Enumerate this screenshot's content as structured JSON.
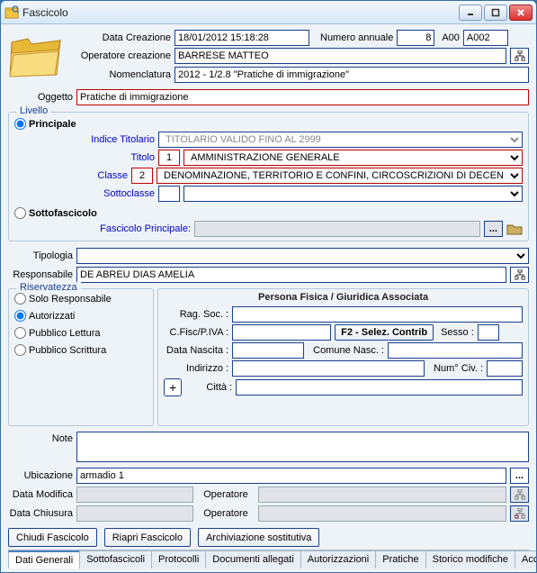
{
  "window": {
    "title": "Fascicolo"
  },
  "header": {
    "data_creazione_label": "Data Creazione",
    "data_creazione": "18/01/2012 15:18:28",
    "numero_annuale_label": "Numero annuale",
    "numero_annuale": "8",
    "aoo_label": "A00",
    "aoo_value": "A002",
    "operatore_creazione_label": "Operatore creazione",
    "operatore_creazione": "BARRESE MATTEO",
    "nomenclatura_label": "Nomenclatura",
    "nomenclatura": "2012 - 1/2.8 \"Pratiche di immigrazione\""
  },
  "oggetto": {
    "label": "Oggetto",
    "value": "Pratiche di immigrazione"
  },
  "livello": {
    "legend": "Livello",
    "principale": "Principale",
    "indice_titolario_label": "Indice Titolario",
    "indice_titolario": "TITOLARIO VALIDO FINO AL 2999",
    "titolo_label": "Titolo",
    "titolo_num": "1",
    "titolo_val": "AMMINISTRAZIONE GENERALE",
    "classe_label": "Classe",
    "classe_num": "2",
    "classe_val": "DENOMINAZIONE, TERRITORIO E CONFINI, CIRCOSCRIZIONI DI DECEN",
    "sottoclasse_label": "Sottoclasse",
    "sottoclasse_num": "",
    "sottoclasse_val": "",
    "sottofascicolo": "Sottofascicolo",
    "fascicolo_principale_label": "Fascicolo Principale:",
    "fascicolo_principale": ""
  },
  "tipologia": {
    "label": "Tipologia",
    "value": ""
  },
  "responsabile": {
    "label": "Responsabile",
    "value": "DE ABREU DIAS AMELIA"
  },
  "riservatezza": {
    "legend": "Riservatezza",
    "solo_responsabile": "Solo Responsabile",
    "autorizzati": "Autorizzati",
    "pubblico_lettura": "Pubblico Lettura",
    "pubblico_scrittura": "Pubblico Scrittura"
  },
  "persona": {
    "heading": "Persona Fisica / Giuridica Associata",
    "rag_soc": "Rag. Soc. :",
    "cfisc": "C.Fisc/P.IVA :",
    "selez_contrib": "F2 - Selez. Contrib",
    "sesso": "Sesso :",
    "data_nascita": "Data Nascita :",
    "comune_nasc": "Comune Nasc. :",
    "indirizzo": "Indirizzo :",
    "num_civ": "Num° Civ. :",
    "citta": "Città :",
    "plus": "+"
  },
  "note": {
    "label": "Note",
    "value": ""
  },
  "ubicazione": {
    "label": "Ubicazione",
    "value": "armadio 1"
  },
  "data_modifica": {
    "label": "Data Modifica",
    "value": "",
    "operatore_label": "Operatore",
    "operatore": ""
  },
  "data_chiusura": {
    "label": "Data Chiusura",
    "value": "",
    "operatore_label": "Operatore",
    "operatore": ""
  },
  "buttons": {
    "chiudi": "Chiudi Fascicolo",
    "riapri": "Riapri Fascicolo",
    "archiviazione": "Archiviazione sostitutiva"
  },
  "tabs": [
    "Dati Generali",
    "Sottofascicoli",
    "Protocolli",
    "Documenti allegati",
    "Autorizzazioni",
    "Pratiche",
    "Storico modifiche",
    "Accessi"
  ]
}
